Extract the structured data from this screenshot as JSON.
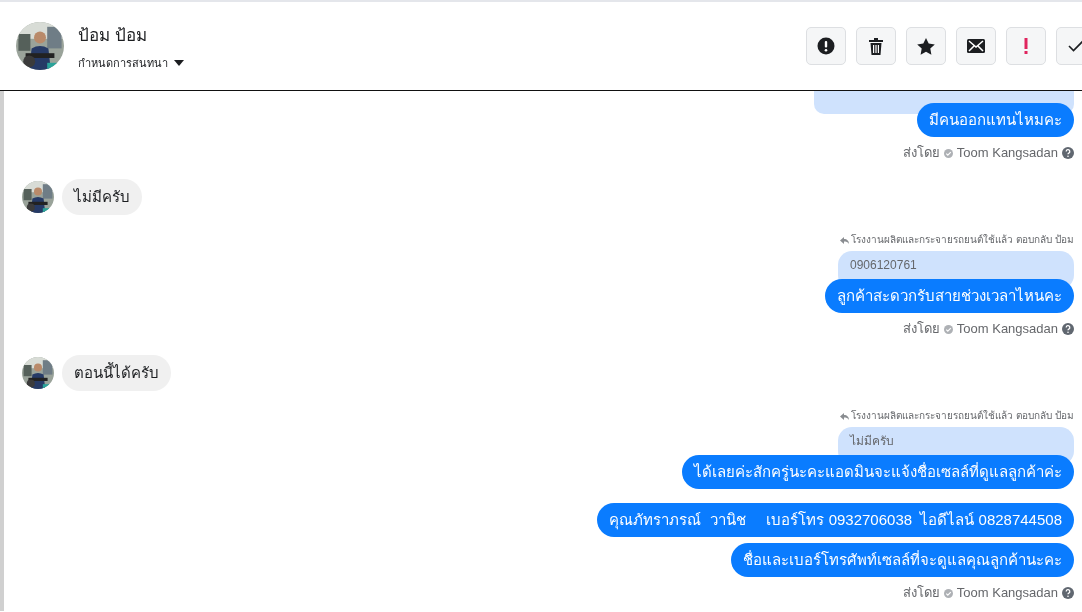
{
  "header": {
    "name": "ป้อม ป้อม",
    "assign_label": "กำหนดการสนทนา"
  },
  "actions": [
    {
      "kind": "alert"
    },
    {
      "kind": "trash"
    },
    {
      "kind": "star"
    },
    {
      "kind": "mail"
    },
    {
      "kind": "bang"
    },
    {
      "kind": "check"
    }
  ],
  "messages": [
    {
      "kind": "outgoing",
      "quote_stub": true,
      "bubbles": [
        "มีคนออกแทนไหมคะ"
      ],
      "sent_by_label": "ส่งโดย",
      "sent_by": "Toom Kangsadan"
    },
    {
      "kind": "incoming",
      "text": "ไม่มีครับ"
    },
    {
      "kind": "outgoing",
      "reply_label": "โรงงานผลิตและกระจายรถยนต์ใช้แล้ว ตอบกลับ ป้อม",
      "quote": "0906120761",
      "bubbles": [
        "ลูกค้าสะดวกรับสายช่วงเวลาไหนคะ"
      ],
      "sent_by_label": "ส่งโดย",
      "sent_by": "Toom Kangsadan"
    },
    {
      "kind": "incoming",
      "text": "ตอนนี้ได้ครับ"
    },
    {
      "kind": "outgoing",
      "reply_label": "โรงงานผลิตและกระจายรถยนต์ใช้แล้ว ตอบกลับ ป้อม",
      "quote": "ไม่มีครับ",
      "bubbles": [
        "ได้เลยค่ะสักครู่นะคะแอดมินจะแจ้งชื่อเซลล์ที่ดูแลลูกค้าค่ะ",
        "คุณภัทราภรณ์  วานิช     เบอร์โทร 0932706038  ไอดีไลน์ 0828744508",
        "ชื่อและเบอร์โทรศัพท์เซลล์ที่จะดูแลคุณลูกค้านะคะ"
      ],
      "sent_by_label": "ส่งโดย",
      "sent_by": "Toom Kangsadan"
    }
  ]
}
